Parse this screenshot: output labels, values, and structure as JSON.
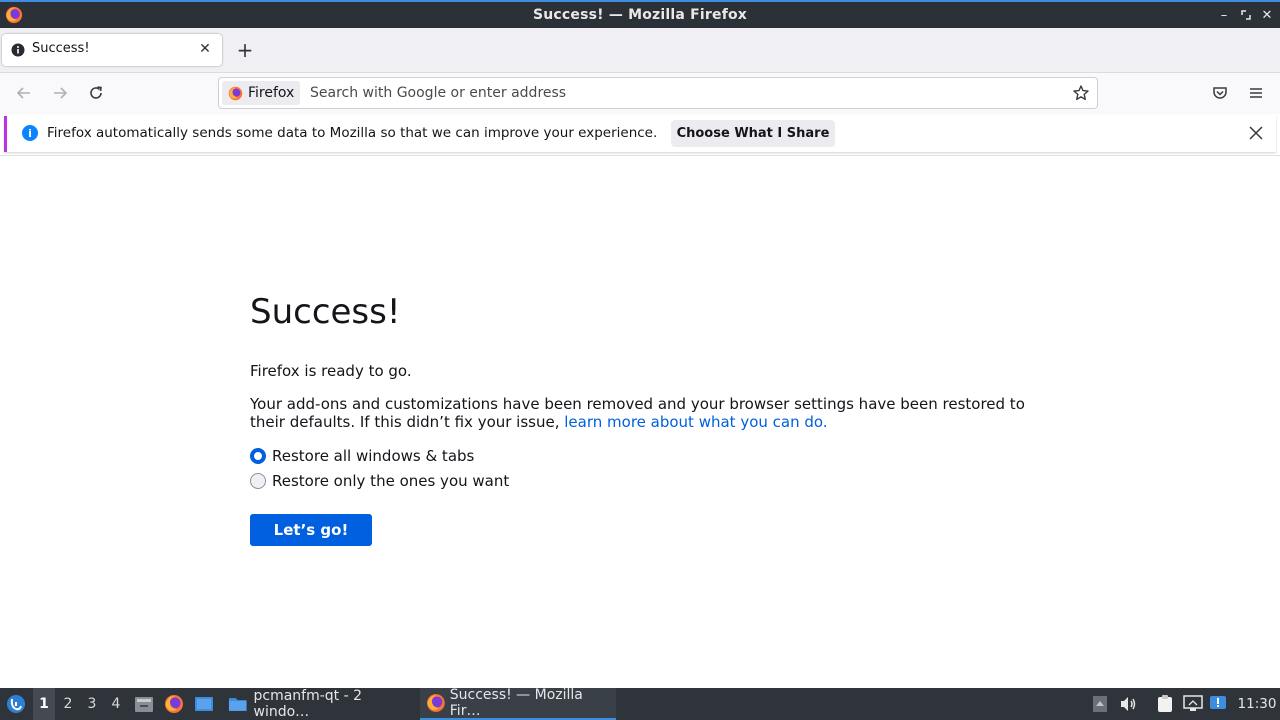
{
  "window": {
    "title": "Success! — Mozilla Firefox"
  },
  "tabs": [
    {
      "label": "Success!"
    }
  ],
  "navbar": {
    "identity_label": "Firefox",
    "search_placeholder": "Search with Google or enter address"
  },
  "notification": {
    "message": "Firefox automatically sends some data to Mozilla so that we can improve your experience.",
    "button_label": "Choose What I Share",
    "accent_color": "#b833e1"
  },
  "page": {
    "title": "Success!",
    "ready_text": "Firefox is ready to go.",
    "paragraph": "Your add-ons and customizations have been removed and your browser settings have been restored to their defaults. If this didn’t fix your issue, ",
    "link_text": "learn more about what you can do.",
    "options": [
      {
        "label": "Restore all windows & tabs",
        "selected": true
      },
      {
        "label": "Restore only the ones you want",
        "selected": false
      }
    ],
    "go_button_label": "Let’s go!",
    "accent_color": "#0060df"
  },
  "taskbar": {
    "workspaces": [
      "1",
      "2",
      "3",
      "4"
    ],
    "active_workspace": "1",
    "tasks": [
      {
        "label": "pcmanfm-qt - 2 windo…",
        "icon": "folder-icon",
        "active": false
      },
      {
        "label": "Success! — Mozilla Fir…",
        "icon": "firefox-icon",
        "active": true
      }
    ],
    "clock": "11:30"
  }
}
